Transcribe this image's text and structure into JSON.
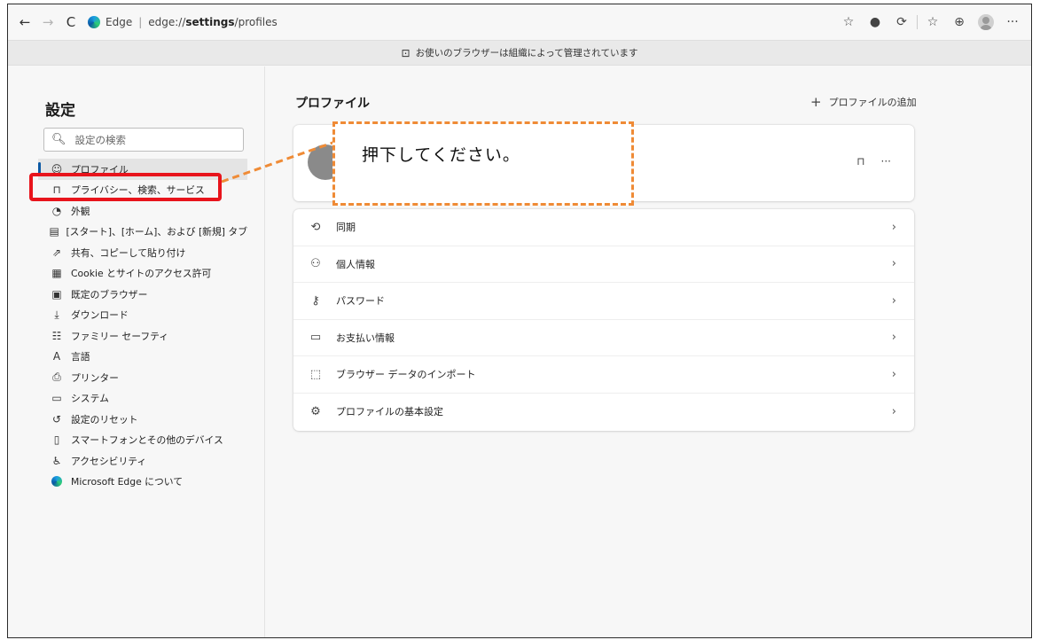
{
  "toolbar": {
    "back": "←",
    "forward": "→",
    "refresh": "C",
    "site_name": "Edge",
    "url_prefix": "edge://",
    "url_bold": "settings",
    "url_suffix": "/profiles",
    "more": "···"
  },
  "managed_bar": {
    "text": "お使いのブラウザーは組織によって管理されています"
  },
  "sidebar": {
    "title": "設定",
    "search_placeholder": "設定の検索",
    "items": [
      {
        "label": "プロファイル",
        "icon": "profile-icon"
      },
      {
        "label": "プライバシー、検索、サービス",
        "icon": "lock-icon"
      },
      {
        "label": "外観",
        "icon": "appearance-icon"
      },
      {
        "label": "[スタート]、[ホーム]、および [新規] タブ",
        "icon": "start-home-icon"
      },
      {
        "label": "共有、コピーして貼り付け",
        "icon": "share-icon"
      },
      {
        "label": "Cookie とサイトのアクセス許可",
        "icon": "cookie-icon"
      },
      {
        "label": "既定のブラウザー",
        "icon": "default-browser-icon"
      },
      {
        "label": "ダウンロード",
        "icon": "download-icon"
      },
      {
        "label": "ファミリー セーフティ",
        "icon": "family-icon"
      },
      {
        "label": "言語",
        "icon": "language-icon"
      },
      {
        "label": "プリンター",
        "icon": "printer-icon"
      },
      {
        "label": "システム",
        "icon": "system-icon"
      },
      {
        "label": "設定のリセット",
        "icon": "reset-icon"
      },
      {
        "label": "スマートフォンとその他のデバイス",
        "icon": "phone-icon"
      },
      {
        "label": "アクセシビリティ",
        "icon": "accessibility-icon"
      },
      {
        "label": "Microsoft Edge について",
        "icon": "edge-logo-icon"
      }
    ]
  },
  "main": {
    "title": "プロファイル",
    "add_profile": "プロファイルの追加",
    "profile_more": "···",
    "rows": [
      {
        "label": "同期",
        "icon": "sync-icon"
      },
      {
        "label": "個人情報",
        "icon": "personal-info-icon"
      },
      {
        "label": "パスワード",
        "icon": "key-icon"
      },
      {
        "label": "お支払い情報",
        "icon": "credit-card-icon"
      },
      {
        "label": "ブラウザー データのインポート",
        "icon": "import-icon"
      },
      {
        "label": "プロファイルの基本設定",
        "icon": "profile-settings-icon"
      }
    ]
  },
  "annotation": {
    "callout_text": "押下してください。",
    "border_color": "#ef8b36",
    "highlight_color": "#e8141c"
  },
  "colors": {
    "accent": "#0c59a4"
  }
}
